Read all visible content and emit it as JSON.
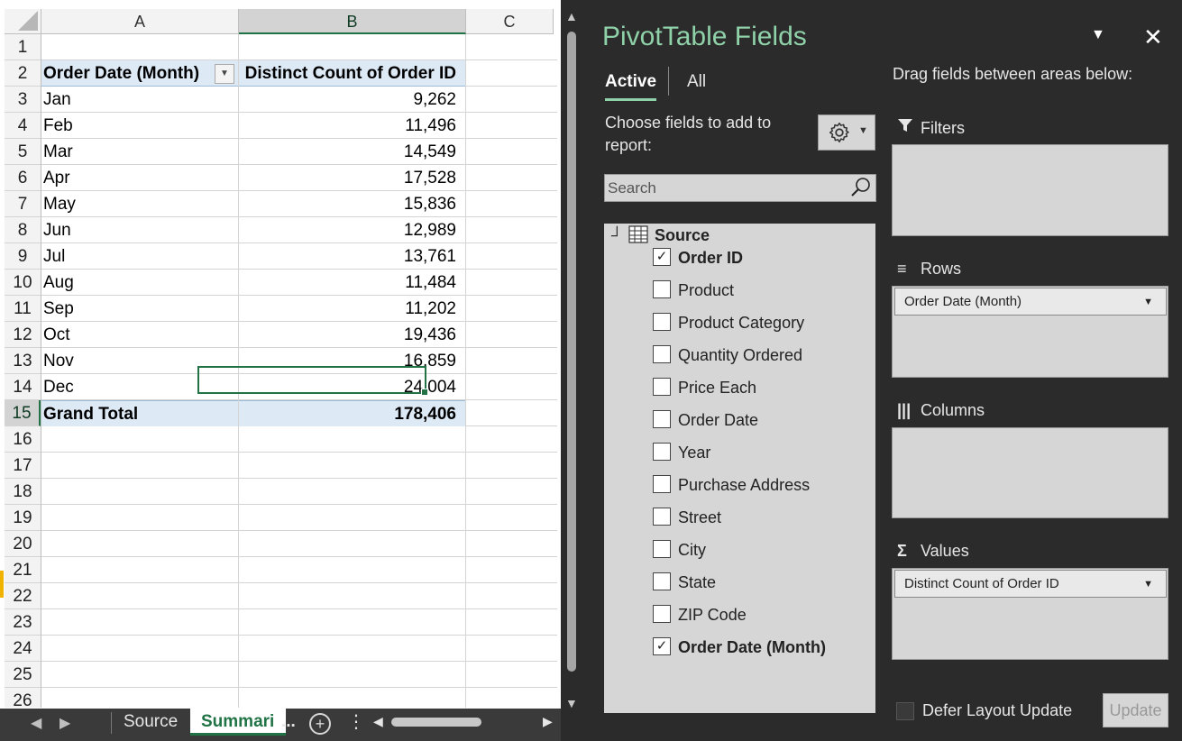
{
  "sheet": {
    "columns": [
      "A",
      "B",
      "C"
    ],
    "rows": [
      "1",
      "2",
      "3",
      "4",
      "5",
      "6",
      "7",
      "8",
      "9",
      "10",
      "11",
      "12",
      "13",
      "14",
      "15",
      "16",
      "17",
      "18",
      "19",
      "20",
      "21",
      "22",
      "23",
      "24",
      "25",
      "26"
    ],
    "pivot": {
      "header_a": "Order Date (Month)",
      "header_b": "Distinct Count of Order ID",
      "data": [
        {
          "month": "Jan",
          "count": "9,262"
        },
        {
          "month": "Feb",
          "count": "11,496"
        },
        {
          "month": "Mar",
          "count": "14,549"
        },
        {
          "month": "Apr",
          "count": "17,528"
        },
        {
          "month": "May",
          "count": "15,836"
        },
        {
          "month": "Jun",
          "count": "12,989"
        },
        {
          "month": "Jul",
          "count": "13,761"
        },
        {
          "month": "Aug",
          "count": "11,484"
        },
        {
          "month": "Sep",
          "count": "11,202"
        },
        {
          "month": "Oct",
          "count": "19,436"
        },
        {
          "month": "Nov",
          "count": "16,859"
        },
        {
          "month": "Dec",
          "count": "24,004"
        }
      ],
      "total_label": "Grand Total",
      "total_value": "178,406"
    },
    "tabs": {
      "source": "Source",
      "summary": "Summari",
      "more": "...",
      "add_icon": "plus-circle-icon"
    }
  },
  "pane": {
    "title": "PivotTable Fields",
    "tab_active": "Active",
    "tab_all": "All",
    "drag_text": "Drag fields between areas below:",
    "choose_text": "Choose fields to add to report:",
    "search_placeholder": "Search",
    "source_label": "Source",
    "fields": [
      {
        "label": "Order ID",
        "checked": true
      },
      {
        "label": "Product",
        "checked": false
      },
      {
        "label": "Product Category",
        "checked": false
      },
      {
        "label": "Quantity Ordered",
        "checked": false
      },
      {
        "label": "Price Each",
        "checked": false
      },
      {
        "label": "Order Date",
        "checked": false
      },
      {
        "label": "Year",
        "checked": false
      },
      {
        "label": "Purchase Address",
        "checked": false
      },
      {
        "label": "Street",
        "checked": false
      },
      {
        "label": "City",
        "checked": false
      },
      {
        "label": "State",
        "checked": false
      },
      {
        "label": "ZIP Code",
        "checked": false
      },
      {
        "label": "Order Date (Month)",
        "checked": true
      }
    ],
    "areas": {
      "filters": "Filters",
      "rows": "Rows",
      "columns": "Columns",
      "values": "Values",
      "rows_chip": "Order Date (Month)",
      "values_chip": "Distinct Count of Order ID"
    },
    "defer_label": "Defer Layout Update",
    "update_label": "Update",
    "accent_color": "#217346",
    "title_color": "#8fd1a8"
  }
}
